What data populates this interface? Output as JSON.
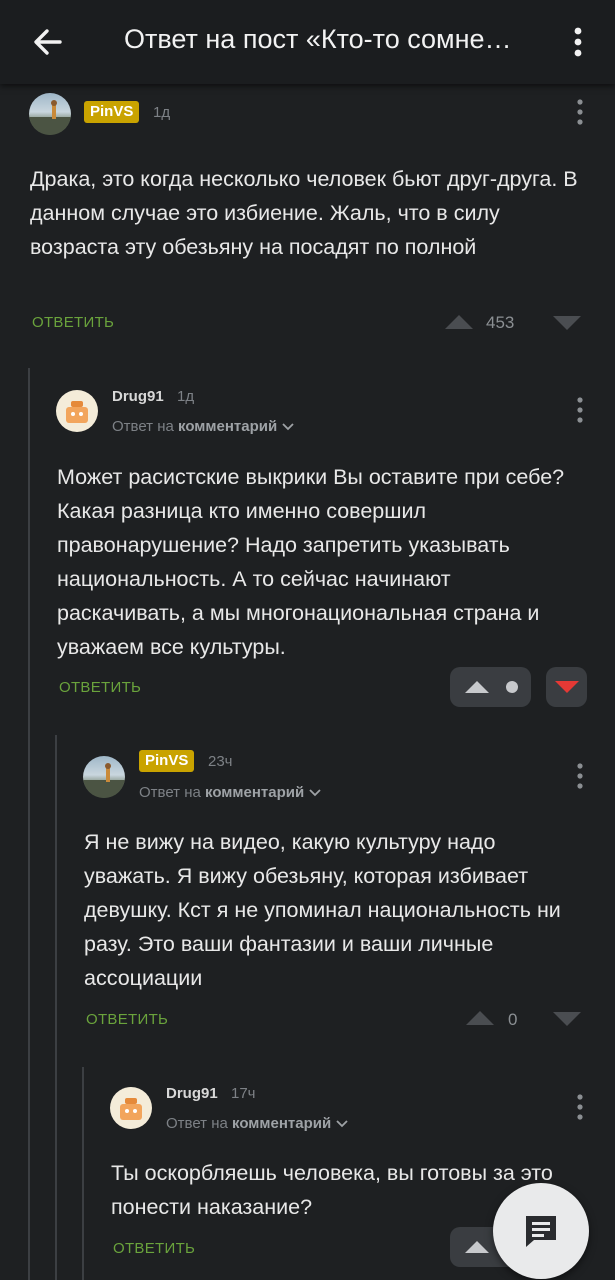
{
  "header": {
    "title": "Ответ на пост «Кто-то сомне…",
    "back_icon": "arrow-left-icon",
    "menu_icon": "more-vertical-icon"
  },
  "colors": {
    "background": "#1e2022",
    "accent_green": "#6aa33c",
    "badge_yellow": "#c9a300",
    "downvote_red": "#e53935"
  },
  "comments": [
    {
      "author": "PinVS",
      "time": "1д",
      "text": "Драка, это когда несколько человек бьют друг-друга. В данном случае это избиение. Жаль, что в силу возраста эту обезьяну на посадят по полной",
      "reply_label": "ОТВЕТИТЬ",
      "score": "453"
    },
    {
      "author": "Drug91",
      "time": "1д",
      "reply_prefix": "Ответ на",
      "reply_target": "комментарий",
      "text": "Может расистские выкрики Вы оставите при себе? Какая разница кто именно совершил правонарушение? Надо запретить указывать национальность. А то сейчас начинают раскачивать, а мы многонациональная страна и уважаем все культуры.",
      "reply_label": "ОТВЕТИТЬ"
    },
    {
      "author": "PinVS",
      "time": "23ч",
      "reply_prefix": "Ответ на",
      "reply_target": "комментарий",
      "text": "Я не вижу на видео, какую культуру надо уважать. Я вижу обезьяну, которая избивает девушку. Кст я не упоминал национальность ни разу. Это ваши фантазии и ваши личные ассоциации",
      "reply_label": "ОТВЕТИТЬ",
      "score": "0"
    },
    {
      "author": "Drug91",
      "time": "17ч",
      "reply_prefix": "Ответ на",
      "reply_target": "комментарий",
      "text": "Ты оскорбляешь человека, вы готовы за это понести наказание?",
      "reply_label": "ОТВЕТИТЬ"
    }
  ],
  "fab": {
    "icon": "comment-icon"
  }
}
